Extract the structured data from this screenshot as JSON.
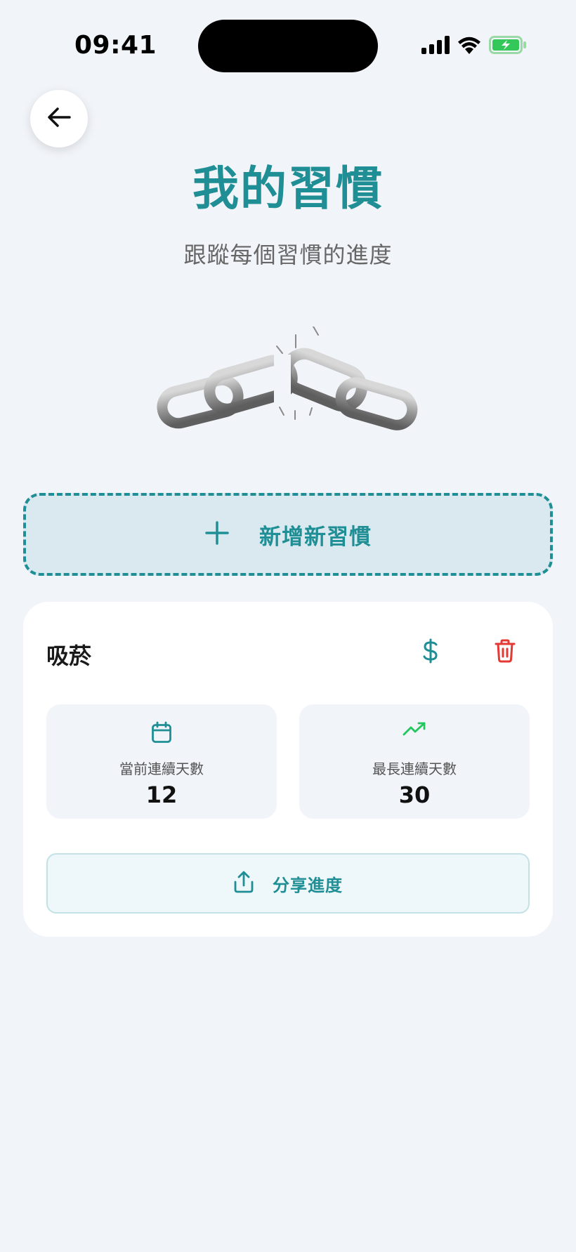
{
  "status_bar": {
    "time": "09:41"
  },
  "header": {
    "title": "我的習慣",
    "subtitle": "跟蹤每個習慣的進度"
  },
  "add_habit": {
    "label": "新增新習慣"
  },
  "habit": {
    "name": "吸菸",
    "current_streak": {
      "label": "當前連續天數",
      "value": "12"
    },
    "longest_streak": {
      "label": "最長連續天數",
      "value": "30"
    },
    "share_label": "分享進度"
  },
  "icons": {
    "back": "arrow-left-icon",
    "add": "plus-icon",
    "money": "dollar-icon",
    "delete": "trash-icon",
    "calendar": "calendar-icon",
    "trend": "trending-up-icon",
    "share": "share-icon"
  },
  "colors": {
    "accent": "#1f8f95",
    "danger": "#e53935",
    "trend": "#22c55e",
    "background": "#f1f4f9",
    "battery": "#34c759"
  }
}
